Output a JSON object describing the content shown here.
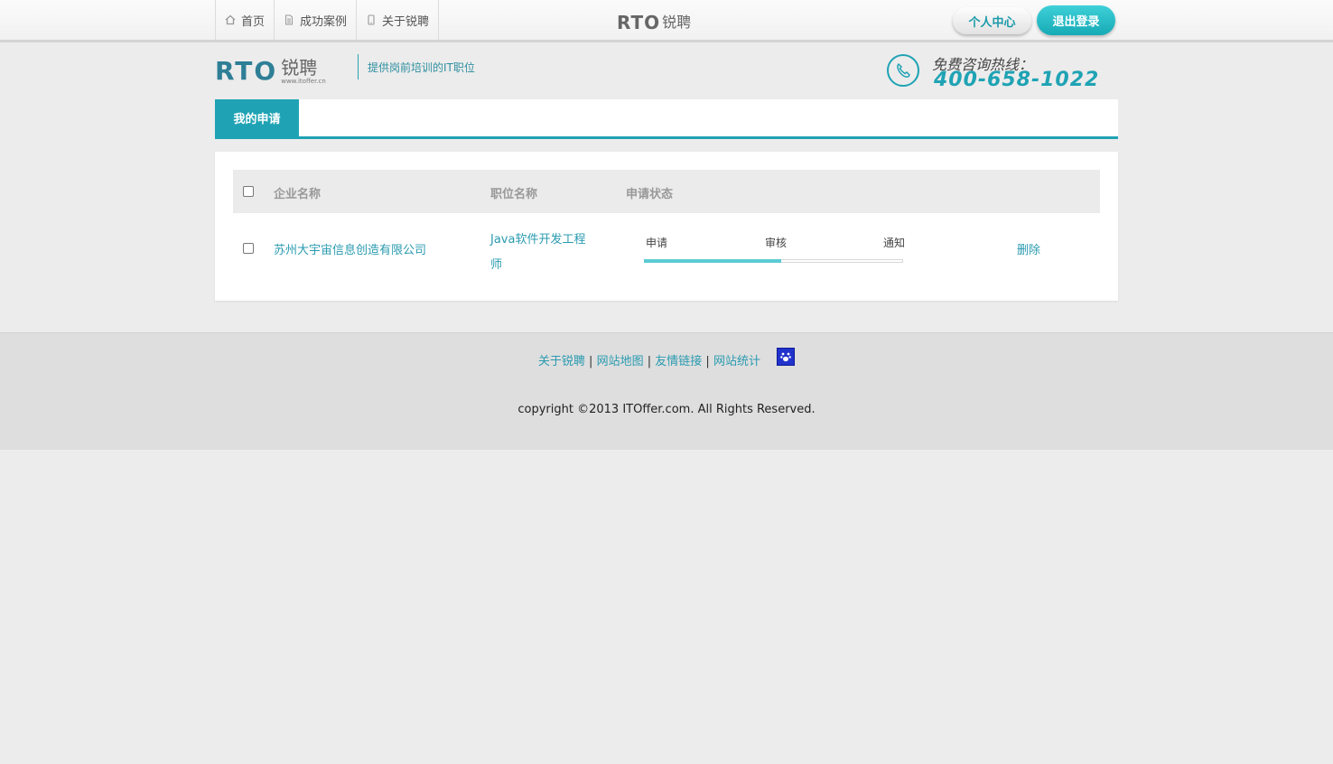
{
  "nav": {
    "items": [
      {
        "label": "首页",
        "icon": "home-icon"
      },
      {
        "label": "成功案例",
        "icon": "document-icon"
      },
      {
        "label": "关于锐聘",
        "icon": "phone-icon"
      }
    ],
    "brand_logo": "RTO",
    "brand_logo_cn": "锐聘",
    "personal_center": "个人中心",
    "logout": "退出登录"
  },
  "header": {
    "logo_en": "RTO",
    "logo_cn": "锐聘",
    "logo_site": "www.itoffer.cn",
    "slogan": "提供岗前培训的IT职位",
    "hotline_label": "免费咨询热线：",
    "hotline_number": "400-658-1022"
  },
  "tabs": [
    {
      "label": "我的申请",
      "active": true
    }
  ],
  "table": {
    "headers": [
      "企业名称",
      "职位名称",
      "申请状态"
    ],
    "rows": [
      {
        "company": "苏州大宇宙信息创造有限公司",
        "position_line1": "Java软件开发工程",
        "position_line2": "师",
        "steps": [
          "申请",
          "审核",
          "通知"
        ],
        "progress": 0.53,
        "action": "删除"
      }
    ]
  },
  "footer": {
    "links": [
      "关于锐聘",
      "网站地图",
      "友情链接",
      "网站统计"
    ],
    "separator": "|",
    "copyright": "copyright ©2013 ITOffer.com. All Rights Reserved."
  },
  "colors": {
    "accent": "#1fa3b4",
    "link": "#2a9bb0",
    "progress_fill": "#5ccbd4"
  }
}
